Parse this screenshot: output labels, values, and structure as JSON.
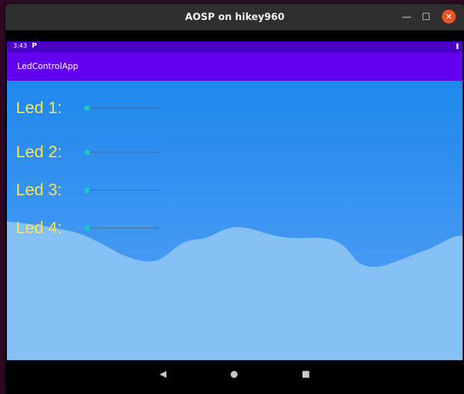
{
  "window": {
    "title": "AOSP on hikey960",
    "min_glyph": "—",
    "max_glyph": "☐",
    "close_glyph": "✕"
  },
  "status": {
    "time": "3:43",
    "notification_icon": "P"
  },
  "app": {
    "title": "LedControlApp"
  },
  "leds": [
    {
      "label": "Led 1:",
      "level": 0
    },
    {
      "label": "Led 2:",
      "level": 0
    },
    {
      "label": "Led 3:",
      "level": 0
    },
    {
      "label": "Led 4:",
      "level": 0
    }
  ],
  "nav": {
    "back": "◀",
    "home": "●",
    "recent": "■"
  },
  "colors": {
    "statusbar": "#4a02c5",
    "appbar": "#6200ee",
    "label": "#f8e35a",
    "thumb": "#1ec8c0",
    "close_button": "#e95420"
  }
}
